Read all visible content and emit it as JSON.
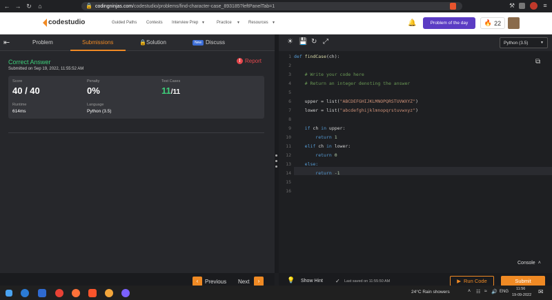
{
  "browser": {
    "url_host": "codingninjas.com",
    "url_path": "/codestudio/problems/find-character-case_893185?leftPanelTab=1"
  },
  "site": {
    "logo_text": "codestudio",
    "nav": [
      "Guided Paths",
      "Contests",
      "Interview Prep",
      "Practice",
      "Resources"
    ],
    "potd_label": "Problem of the day",
    "streak_count": "22"
  },
  "tabs": {
    "problem": "Problem",
    "submissions": "Submissions",
    "solution": "Solution",
    "discuss_badge": "New",
    "discuss": "Discuss"
  },
  "result": {
    "status": "Correct Answer",
    "submitted_on": "Submitted on Sep 19, 2022, 11:55:52 AM",
    "report_label": "Report",
    "score_label": "Score",
    "score_value": "40 / 40",
    "penalty_label": "Penalty",
    "penalty_value": "0%",
    "testcases_label": "Test Cases",
    "testcases_passed": "11",
    "testcases_total": "/11",
    "runtime_label": "Runtime",
    "runtime_value": "614ms",
    "language_label": "Language",
    "language_value": "Python (3.5)"
  },
  "pager": {
    "previous": "Previous",
    "next": "Next"
  },
  "editor": {
    "language": "Python (3.5)",
    "line_numbers": [
      "1",
      "2",
      "3",
      "4",
      "5",
      "6",
      "7",
      "8",
      "9",
      "10",
      "11",
      "12",
      "13",
      "14",
      "15",
      "16"
    ],
    "console_label": "Console",
    "show_hint": "Show Hint",
    "last_saved": "Last saved on 11:55:50 AM",
    "run_code": "Run Code",
    "submit": "Submit"
  },
  "code": {
    "l1_kw": "def ",
    "l1_fn": "findCase",
    "l1_rest": "(ch):",
    "l3": "    # Write your code here",
    "l4": "    # Return an integer denoting the answer",
    "l6_a": "    upper = list(",
    "l6_s": "\"ABCDEFGHIJKLMNOPQRSTUVWXYZ\"",
    "l6_b": ")",
    "l7_a": "    lower = list(",
    "l7_s": "\"abcdefghijklmnopqrstuvwxyz\"",
    "l7_b": ")",
    "l9_kw": "    if ",
    "l9_a": "ch ",
    "l9_kw2": "in ",
    "l9_b": "upper:",
    "l10_kw": "        return ",
    "l10_n": "1",
    "l11_kw": "    elif ",
    "l11_a": "ch ",
    "l11_kw2": "in ",
    "l11_b": "lower:",
    "l12_kw": "        return ",
    "l12_n": "0",
    "l13_kw": "    else:",
    "l14_kw": "        return ",
    "l14_n": "-1"
  },
  "taskbar": {
    "weather": "24°C  Rain showers",
    "lang": "ENG",
    "time": "11:56",
    "date": "19-09-2022"
  }
}
